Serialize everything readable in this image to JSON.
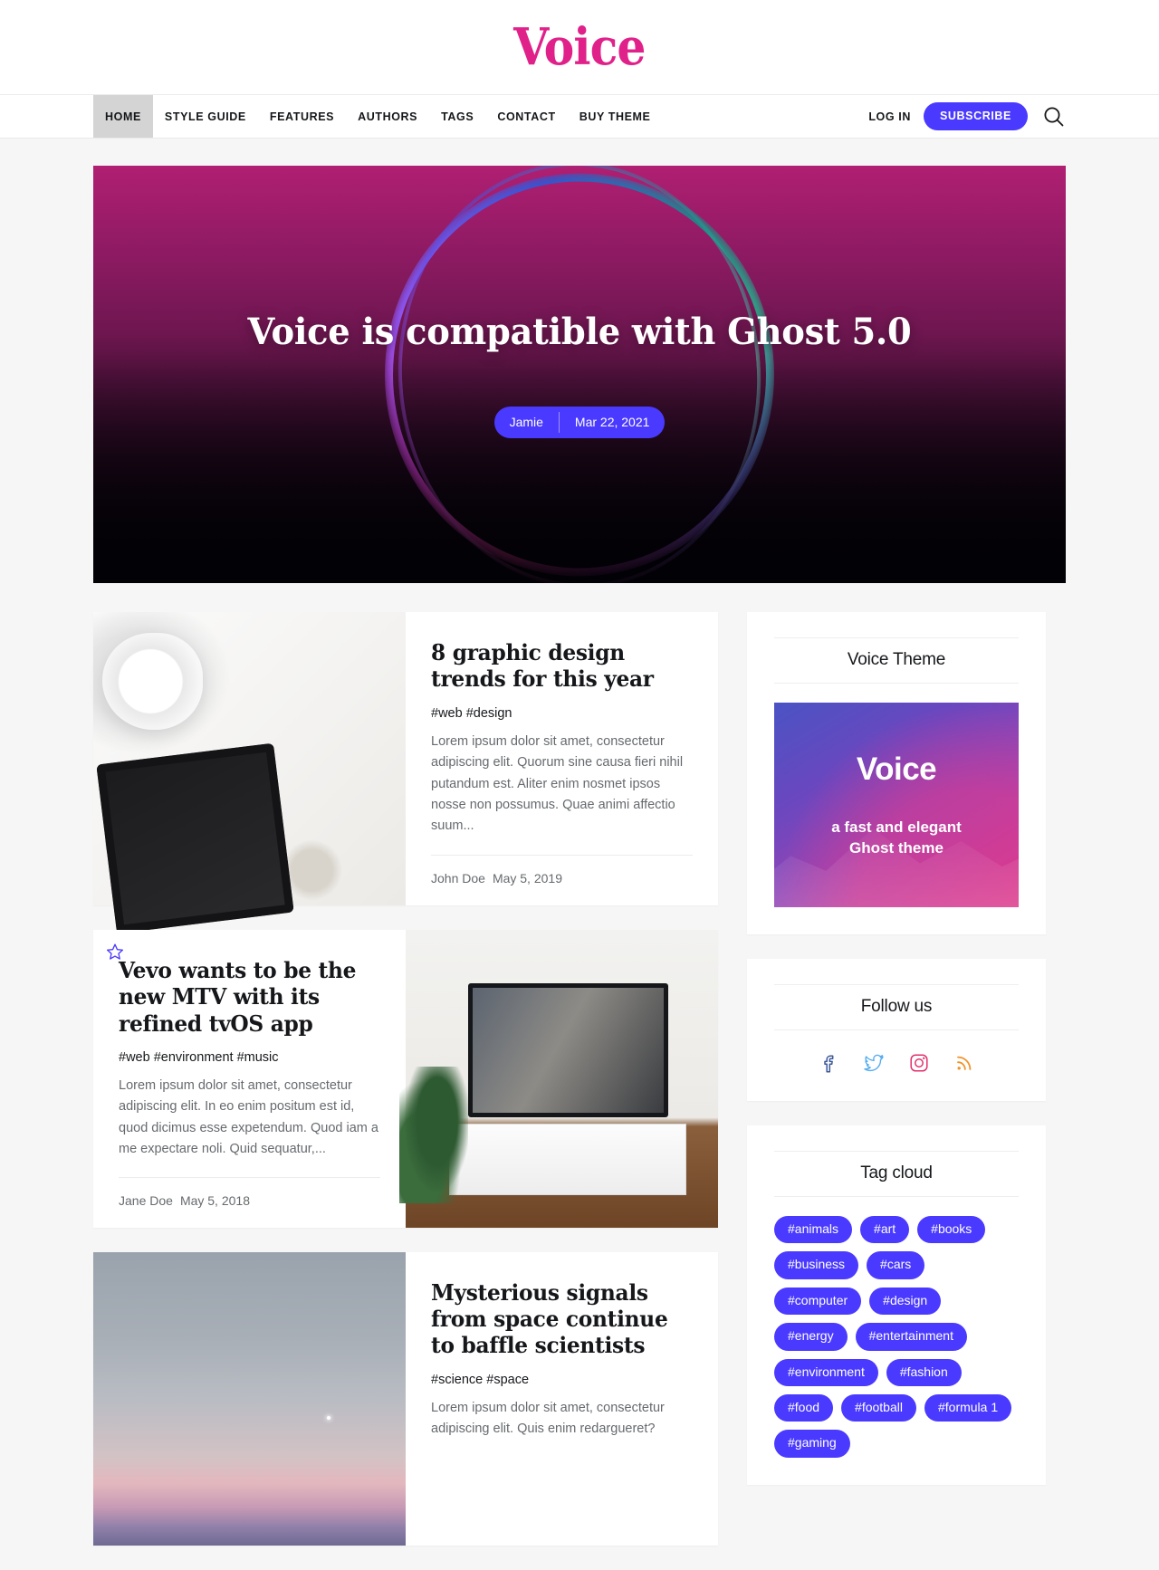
{
  "site": {
    "logo_text": "Voice"
  },
  "nav": {
    "items": [
      {
        "label": "HOME",
        "active": true
      },
      {
        "label": "STYLE GUIDE",
        "active": false
      },
      {
        "label": "FEATURES",
        "active": false
      },
      {
        "label": "AUTHORS",
        "active": false
      },
      {
        "label": "TAGS",
        "active": false
      },
      {
        "label": "CONTACT",
        "active": false
      },
      {
        "label": "BUY THEME",
        "active": false
      }
    ],
    "login_label": "LOG IN",
    "subscribe_label": "SUBSCRIBE",
    "search_icon": "search-icon"
  },
  "hero": {
    "title": "Voice is compatible with Ghost 5.0",
    "author": "Jamie",
    "date": "Mar 22, 2021"
  },
  "posts": [
    {
      "title": "8 graphic design trends for this year",
      "tags": "#web #design",
      "excerpt": "Lorem ipsum dolor sit amet, consectetur adipiscing elit. Quorum sine causa fieri nihil putandum est. Aliter enim nosmet ipsos nosse non possumus. Quae animi affectio suum...",
      "author": "John Doe",
      "date": "May 5, 2019",
      "image": "desk-flatlay-photo",
      "featured": false,
      "image_side": "left"
    },
    {
      "title": "Vevo wants to be the new MTV with its refined tvOS app",
      "tags": "#web #environment #music",
      "excerpt": "Lorem ipsum dolor sit amet, consectetur adipiscing elit. In eo enim positum est id, quod dicimus esse expetendum. Quod iam a me expectare noli. Quid sequatur,...",
      "author": "Jane Doe",
      "date": "May 5, 2018",
      "image": "television-livingroom-photo",
      "featured": true,
      "image_side": "right"
    },
    {
      "title": "Mysterious signals from space continue to baffle scientists",
      "tags": "#science #space",
      "excerpt": "Lorem ipsum dolor sit amet, consectetur adipiscing elit. Quis enim redargueret?",
      "author": "",
      "date": "",
      "image": "twilight-sky-photo",
      "featured": false,
      "image_side": "left"
    }
  ],
  "sidebar": {
    "promo": {
      "title": "Voice Theme",
      "image_title": "Voice",
      "image_subtitle": "a fast and elegant\nGhost theme"
    },
    "follow": {
      "title": "Follow us",
      "links": [
        {
          "name": "facebook-icon",
          "color": "#3b5998"
        },
        {
          "name": "twitter-icon",
          "color": "#55acee"
        },
        {
          "name": "instagram-icon",
          "color": "#e1306c"
        },
        {
          "name": "rss-icon",
          "color": "#f0932b"
        }
      ]
    },
    "tag_cloud": {
      "title": "Tag cloud",
      "tags": [
        "#animals",
        "#art",
        "#books",
        "#business",
        "#cars",
        "#computer",
        "#design",
        "#energy",
        "#entertainment",
        "#environment",
        "#fashion",
        "#food",
        "#football",
        "#formula 1",
        "#gaming"
      ]
    }
  },
  "colors": {
    "brand_pink": "#e0218a",
    "accent_blue": "#4a3aff",
    "page_bg": "#f6f6f6",
    "text": "#15171a",
    "muted": "#666a6e"
  }
}
